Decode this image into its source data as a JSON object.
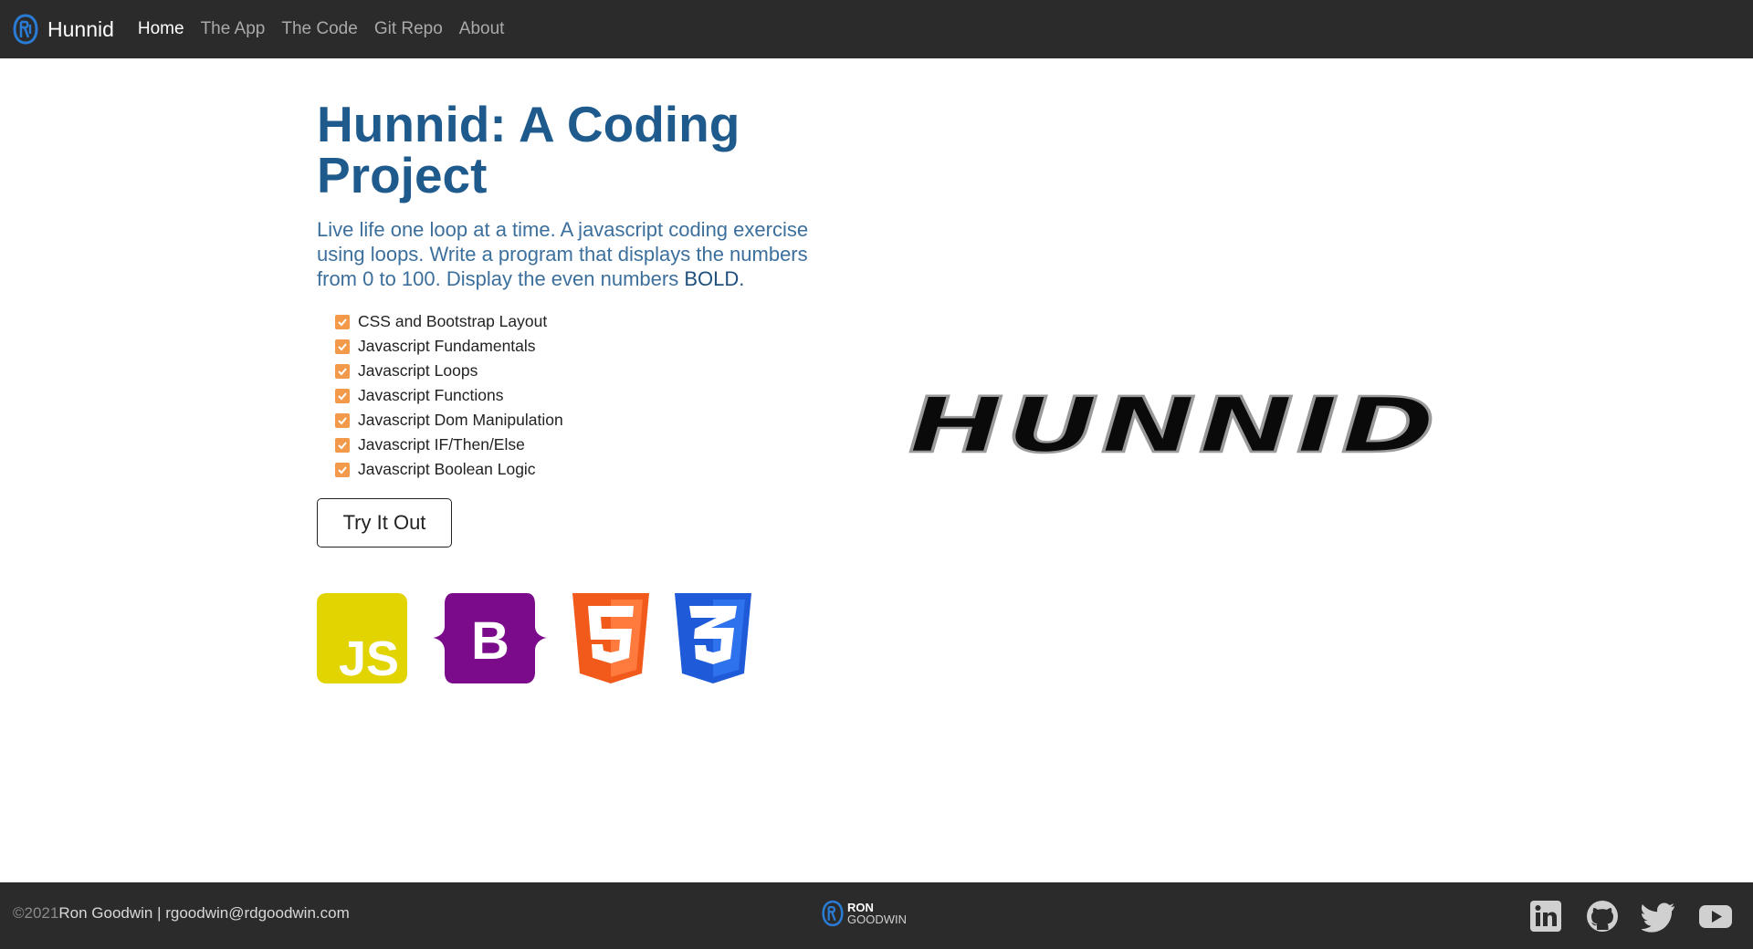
{
  "nav": {
    "brand": "Hunnid",
    "links": [
      "Home",
      "The App",
      "The Code",
      "Git Repo",
      "About"
    ]
  },
  "hero": {
    "title": "Hunnid: A Coding Project",
    "lead": "Live life one loop at a time. A javascript coding exercise using loops. Write a program that displays the numbers from 0 to 100. Display the even numbers",
    "lead_bold": "BOLD.",
    "features": [
      "CSS and Bootstrap Layout",
      "Javascript Fundamentals",
      "Javascript Loops",
      "Javascript Functions",
      "Javascript Dom Manipulation",
      "Javascript IF/Then/Else",
      "Javascript Boolean Logic"
    ],
    "button": "Try It Out",
    "tech_icons": [
      "js-icon",
      "bootstrap-icon",
      "html5-icon",
      "css3-icon"
    ],
    "logo_text": "HUNNID"
  },
  "footer": {
    "year": "©2021",
    "author": "Ron Goodwin | rgoodwin@rdgoodwin.com",
    "logo_line1": "RON",
    "logo_line2": "GOODWIN",
    "socials": [
      "linkedin-icon",
      "github-icon",
      "twitter-icon",
      "youtube-icon"
    ]
  },
  "colors": {
    "nav_bg": "#2b2b2b",
    "title": "#1f5a8d",
    "check": "#f2994a",
    "js": "#e1d400",
    "bootstrap": "#7b0b8b",
    "html5": "#f25a1c",
    "css3": "#1f5bd8"
  }
}
